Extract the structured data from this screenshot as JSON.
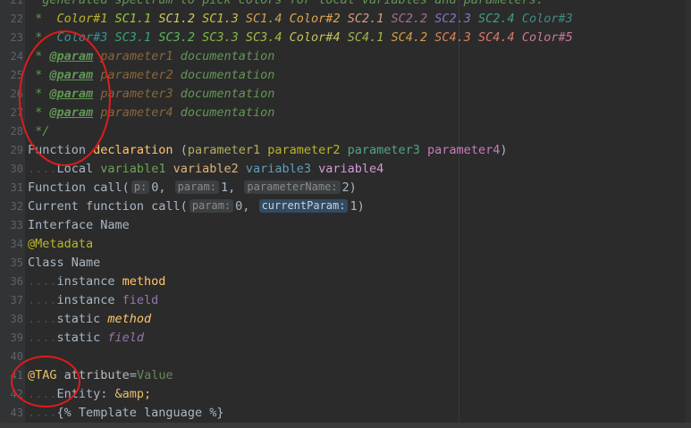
{
  "colors": {
    "background": "#2b2b2b",
    "gutter": "#313335",
    "line_number": "#606366",
    "default_text": "#a9b7c6",
    "doc_comment": "#629755",
    "keyword": "#cc7832",
    "param_tag": "#6a8759",
    "annotation_circle": "#e21b1b"
  },
  "annotations": [
    "red-circle-param-tags",
    "red-circle-tag-keyword"
  ],
  "lines": [
    {
      "n": "21",
      "tokens": [
        {
          "t": "  generated spectrum to pick colors for local variables and parameters:",
          "c": "#629755",
          "i": true
        }
      ]
    },
    {
      "n": "22",
      "tokens": [
        {
          "t": " *  ",
          "c": "#629755",
          "i": true
        },
        {
          "t": "Color#1 ",
          "c": "#bbb529",
          "i": true
        },
        {
          "t": "SC1.1 ",
          "c": "#9acc2c",
          "i": true
        },
        {
          "t": "SC1.2 ",
          "c": "#d0c95c",
          "i": true
        },
        {
          "t": "SC1.3 ",
          "c": "#c7c14a",
          "i": true
        },
        {
          "t": "SC1.4 ",
          "c": "#d5a14a",
          "i": true
        },
        {
          "t": "Color#2 ",
          "c": "#e0a553",
          "i": true
        },
        {
          "t": "SC2.1 ",
          "c": "#d89c80",
          "i": true
        },
        {
          "t": "SC2.2 ",
          "c": "#a56d95",
          "i": true
        },
        {
          "t": "SC2.3 ",
          "c": "#8a71c7",
          "i": true
        },
        {
          "t": "SC2.4 ",
          "c": "#3f9f86",
          "i": true
        },
        {
          "t": "Color#3",
          "c": "#3d8c80",
          "i": true
        }
      ]
    },
    {
      "n": "23",
      "tokens": [
        {
          "t": " *  ",
          "c": "#629755",
          "i": true
        },
        {
          "t": "Color#3 ",
          "c": "#3f8f93",
          "i": true
        },
        {
          "t": "SC3.1 ",
          "c": "#35a374",
          "i": true
        },
        {
          "t": "SC3.2 ",
          "c": "#5fb45a",
          "i": true
        },
        {
          "t": "SC3.3 ",
          "c": "#85b943",
          "i": true
        },
        {
          "t": "SC3.4 ",
          "c": "#a6bd44",
          "i": true
        },
        {
          "t": "Color#4 ",
          "c": "#c5c25b",
          "i": true
        },
        {
          "t": "SC4.1 ",
          "c": "#a6b34b",
          "i": true
        },
        {
          "t": "SC4.2 ",
          "c": "#d49d45",
          "i": true
        },
        {
          "t": "SC4.3 ",
          "c": "#d8855a",
          "i": true
        },
        {
          "t": "SC4.4 ",
          "c": "#d9796e",
          "i": true
        },
        {
          "t": "Color#5",
          "c": "#c8779b",
          "i": true
        }
      ]
    },
    {
      "n": "24",
      "tokens": [
        {
          "t": " * ",
          "c": "#629755",
          "i": true
        },
        {
          "t": "@param",
          "c": "#629755",
          "i": true,
          "b": true,
          "u": true
        },
        {
          "t": " ",
          "c": "#629755"
        },
        {
          "t": "parameter1",
          "c": "#8a653b",
          "i": true
        },
        {
          "t": " documentation",
          "c": "#629755",
          "i": true
        }
      ]
    },
    {
      "n": "25",
      "tokens": [
        {
          "t": " * ",
          "c": "#629755",
          "i": true
        },
        {
          "t": "@param",
          "c": "#629755",
          "i": true,
          "b": true,
          "u": true
        },
        {
          "t": " ",
          "c": "#629755"
        },
        {
          "t": "parameter2",
          "c": "#8a653b",
          "i": true
        },
        {
          "t": " documentation",
          "c": "#629755",
          "i": true
        }
      ]
    },
    {
      "n": "26",
      "tokens": [
        {
          "t": " * ",
          "c": "#629755",
          "i": true
        },
        {
          "t": "@param",
          "c": "#629755",
          "i": true,
          "b": true,
          "u": true
        },
        {
          "t": " ",
          "c": "#629755"
        },
        {
          "t": "parameter3",
          "c": "#8a653b",
          "i": true
        },
        {
          "t": " documentation",
          "c": "#629755",
          "i": true
        }
      ]
    },
    {
      "n": "27",
      "tokens": [
        {
          "t": " * ",
          "c": "#629755",
          "i": true
        },
        {
          "t": "@param",
          "c": "#629755",
          "i": true,
          "b": true,
          "u": true
        },
        {
          "t": " ",
          "c": "#629755"
        },
        {
          "t": "parameter4",
          "c": "#8a653b",
          "i": true
        },
        {
          "t": " documentation",
          "c": "#629755",
          "i": true
        }
      ]
    },
    {
      "n": "28",
      "tokens": [
        {
          "t": " */",
          "c": "#629755",
          "i": true
        }
      ]
    },
    {
      "n": "29",
      "tokens": [
        {
          "t": "Function ",
          "c": "#a9b7c6"
        },
        {
          "t": "declaration",
          "c": "#ffc66d"
        },
        {
          "t": " (",
          "c": "#a9b7c6"
        },
        {
          "t": "parameter1 ",
          "c": "#b3ae60"
        },
        {
          "t": "parameter2 ",
          "c": "#bbb529"
        },
        {
          "t": "parameter3 ",
          "c": "#4fa685"
        },
        {
          "t": "parameter4",
          "c": "#c77dbb"
        },
        {
          "t": ")",
          "c": "#a9b7c6"
        }
      ]
    },
    {
      "n": "30",
      "tokens": [
        {
          "t": "....",
          "dots": true
        },
        {
          "t": "Local ",
          "c": "#a9b7c6"
        },
        {
          "t": "variable1 ",
          "c": "#6ea354"
        },
        {
          "t": "variable2 ",
          "c": "#e0b47a"
        },
        {
          "t": "variable3 ",
          "c": "#5f9eb7"
        },
        {
          "t": "variable4",
          "c": "#d29ad6"
        }
      ]
    },
    {
      "n": "31",
      "tokens": [
        {
          "t": "Function call(",
          "c": "#a9b7c6"
        },
        {
          "hint": "p:"
        },
        {
          "t": "0, ",
          "c": "#a9b7c6"
        },
        {
          "hint": "param:"
        },
        {
          "t": "1, ",
          "c": "#a9b7c6"
        },
        {
          "hint": "parameterName:"
        },
        {
          "t": "2)",
          "c": "#a9b7c6"
        }
      ]
    },
    {
      "n": "32",
      "tokens": [
        {
          "t": "Current function call(",
          "c": "#a9b7c6"
        },
        {
          "hint": "param:"
        },
        {
          "t": "0, ",
          "c": "#a9b7c6"
        },
        {
          "hint": "currentParam:",
          "active": true
        },
        {
          "t": "1)",
          "c": "#a9b7c6"
        }
      ]
    },
    {
      "n": "33",
      "tokens": [
        {
          "t": "Interface Name",
          "c": "#a9b7c6"
        }
      ]
    },
    {
      "n": "34",
      "tokens": [
        {
          "t": "@Metadata",
          "c": "#bbb529"
        }
      ]
    },
    {
      "n": "35",
      "tokens": [
        {
          "t": "Class Name",
          "c": "#a9b7c6"
        }
      ]
    },
    {
      "n": "36",
      "tokens": [
        {
          "t": "....",
          "dots": true
        },
        {
          "t": "instance ",
          "c": "#a9b7c6"
        },
        {
          "t": "method",
          "c": "#ffc66d"
        }
      ]
    },
    {
      "n": "37",
      "tokens": [
        {
          "t": "....",
          "dots": true
        },
        {
          "t": "instance ",
          "c": "#a9b7c6"
        },
        {
          "t": "field",
          "c": "#9876aa"
        }
      ]
    },
    {
      "n": "38",
      "tokens": [
        {
          "t": "....",
          "dots": true
        },
        {
          "t": "static ",
          "c": "#a9b7c6"
        },
        {
          "t": "method",
          "c": "#ffc66d",
          "i": true
        }
      ]
    },
    {
      "n": "39",
      "tokens": [
        {
          "t": "....",
          "dots": true
        },
        {
          "t": "static ",
          "c": "#a9b7c6"
        },
        {
          "t": "field",
          "c": "#9876aa",
          "i": true
        }
      ]
    },
    {
      "n": "40",
      "tokens": []
    },
    {
      "n": "41",
      "tokens": [
        {
          "t": "@TAG",
          "c": "#e8bf6a"
        },
        {
          "t": " ",
          "c": "#a9b7c6"
        },
        {
          "t": "attribute",
          "c": "#bababa"
        },
        {
          "t": "=",
          "c": "#a9b7c6"
        },
        {
          "t": "Value",
          "c": "#6a8759"
        }
      ]
    },
    {
      "n": "42",
      "tokens": [
        {
          "t": "....",
          "dots": true
        },
        {
          "t": "Entity: ",
          "c": "#a9b7c6"
        },
        {
          "t": "&amp;",
          "c": "#e8bf6a"
        }
      ]
    },
    {
      "n": "43",
      "tokens": [
        {
          "t": "....",
          "dots": true
        },
        {
          "t": "{% Template language %}",
          "c": "#a9b7c6"
        }
      ]
    }
  ]
}
